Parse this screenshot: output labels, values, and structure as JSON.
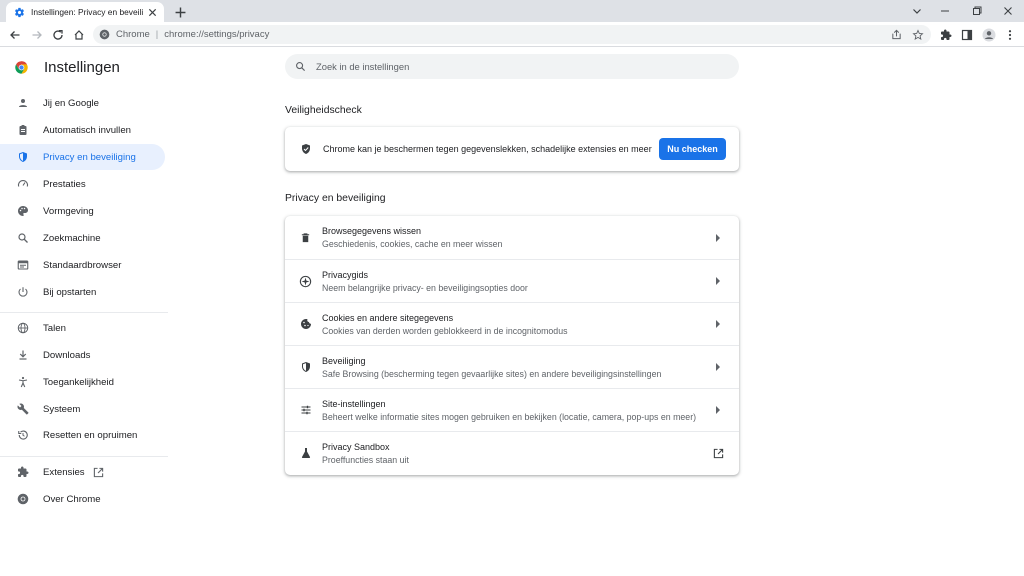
{
  "browser": {
    "tab_title": "Instellingen: Privacy en beveiliging",
    "omnibox": {
      "origin": "Chrome",
      "url": "chrome://settings/privacy"
    }
  },
  "app": {
    "title": "Instellingen"
  },
  "search": {
    "placeholder": "Zoek in de instellingen"
  },
  "sidebar": {
    "items": [
      {
        "label": "Jij en Google",
        "icon": "person-icon"
      },
      {
        "label": "Automatisch invullen",
        "icon": "clipboard-icon"
      },
      {
        "label": "Privacy en beveiliging",
        "icon": "shield-icon",
        "active": true
      },
      {
        "label": "Prestaties",
        "icon": "speedometer-icon"
      },
      {
        "label": "Vormgeving",
        "icon": "palette-icon"
      },
      {
        "label": "Zoekmachine",
        "icon": "search-icon"
      },
      {
        "label": "Standaardbrowser",
        "icon": "browser-window-icon"
      },
      {
        "label": "Bij opstarten",
        "icon": "power-icon"
      },
      {
        "label": "Talen",
        "icon": "globe-icon"
      },
      {
        "label": "Downloads",
        "icon": "download-icon"
      },
      {
        "label": "Toegankelijkheid",
        "icon": "accessibility-icon"
      },
      {
        "label": "Systeem",
        "icon": "wrench-icon"
      },
      {
        "label": "Resetten en opruimen",
        "icon": "restore-icon"
      },
      {
        "label": "Extensies",
        "icon": "puzzle-icon"
      },
      {
        "label": "Over Chrome",
        "icon": "chrome-icon"
      }
    ]
  },
  "safety_check": {
    "heading": "Veiligheidscheck",
    "text": "Chrome kan je beschermen tegen gegevenslekken, schadelijke extensies en meer",
    "button": "Nu checken"
  },
  "privacy": {
    "heading": "Privacy en beveiliging",
    "rows": [
      {
        "title": "Browsegegevens wissen",
        "subtitle": "Geschiedenis, cookies, cache en meer wissen",
        "icon": "trash-icon"
      },
      {
        "title": "Privacygids",
        "subtitle": "Neem belangrijke privacy- en beveiligingsopties door",
        "icon": "compass-icon"
      },
      {
        "title": "Cookies en andere sitegegevens",
        "subtitle": "Cookies van derden worden geblokkeerd in de incognitomodus",
        "icon": "cookie-icon"
      },
      {
        "title": "Beveiliging",
        "subtitle": "Safe Browsing (bescherming tegen gevaarlijke sites) en andere beveiligingsinstellingen",
        "icon": "shield-icon"
      },
      {
        "title": "Site-instellingen",
        "subtitle": "Beheert welke informatie sites mogen gebruiken en bekijken (locatie, camera, pop-ups en meer)",
        "icon": "sliders-icon"
      },
      {
        "title": "Privacy Sandbox",
        "subtitle": "Proeffuncties staan uit",
        "icon": "flask-icon"
      }
    ]
  },
  "colors": {
    "accent": "#1a73e8",
    "active_bg": "#e8f0fe",
    "tabstrip": "#dee1e6",
    "icon": "#5f6368"
  }
}
